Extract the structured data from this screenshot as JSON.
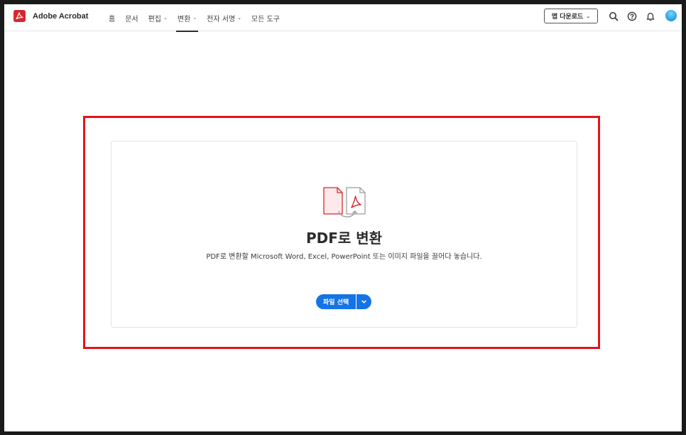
{
  "header": {
    "app_title": "Adobe Acrobat",
    "nav": [
      {
        "label": "홈",
        "has_menu": false,
        "active": false
      },
      {
        "label": "문서",
        "has_menu": false,
        "active": false
      },
      {
        "label": "편집",
        "has_menu": true,
        "active": false
      },
      {
        "label": "변환",
        "has_menu": true,
        "active": true
      },
      {
        "label": "전자 서명",
        "has_menu": true,
        "active": false
      },
      {
        "label": "모든 도구",
        "has_menu": false,
        "active": false
      }
    ],
    "download_label": "앱 다운로드",
    "icons": [
      "search-icon",
      "help-icon",
      "bell-icon",
      "avatar"
    ]
  },
  "main": {
    "title": "PDF로 변환",
    "description": "PDF로 변환할 Microsoft Word, Excel, PowerPoint 또는 이미지 파일을 끌어다 놓습니다.",
    "select_label": "파일 선택"
  },
  "colors": {
    "brand_red": "#d7282f",
    "primary_blue": "#1473e6",
    "highlight_red": "#e3141b"
  }
}
